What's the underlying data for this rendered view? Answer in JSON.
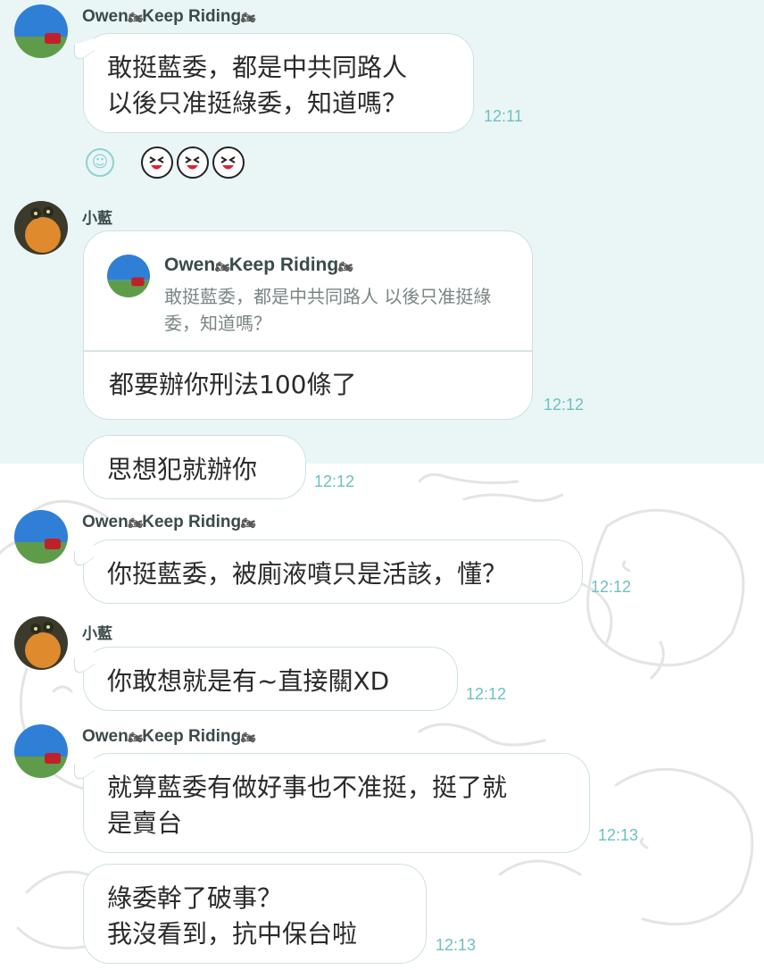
{
  "messages": [
    {
      "sender": "Owen",
      "sender_suffix": "Keep Riding",
      "text": "敢挺藍委，都是中共同路人\n以後只准挺綠委，知道嗎？",
      "time": "12:11"
    },
    {
      "sender": "小藍",
      "reply": {
        "name": "Owen",
        "name_suffix": "Keep Riding",
        "quote": "敢挺藍委，都是中共同路人 以後只准挺綠委，知道嗎？"
      },
      "text": "都要辦你刑法100條了",
      "time": "12:12"
    },
    {
      "sender": "",
      "text": "思想犯就辦你",
      "time": "12:12"
    },
    {
      "sender": "Owen",
      "sender_suffix": "Keep Riding",
      "text": "你挺藍委，被廁液噴只是活該，懂？",
      "time": "12:12"
    },
    {
      "sender": "小藍",
      "text": "你敢想就是有~直接關XD",
      "time": "12:12"
    },
    {
      "sender": "Owen",
      "sender_suffix": "Keep Riding",
      "text": "就算藍委有做好事也不准挺，挺了就\n是賣台",
      "time": "12:13"
    },
    {
      "sender": "",
      "text": "綠委幹了破事？\n 我沒看到，抗中保台啦",
      "time": "12:13"
    }
  ],
  "reactions": {
    "icon": "smiley-add-icon",
    "sticker_icon": "laughing-face-sticker-icon",
    "sticker_count": 3
  },
  "colors": {
    "highlight_bg": "#eaf6f6",
    "time": "#6fc0c0",
    "bubble_border": "#cfe0e0"
  }
}
